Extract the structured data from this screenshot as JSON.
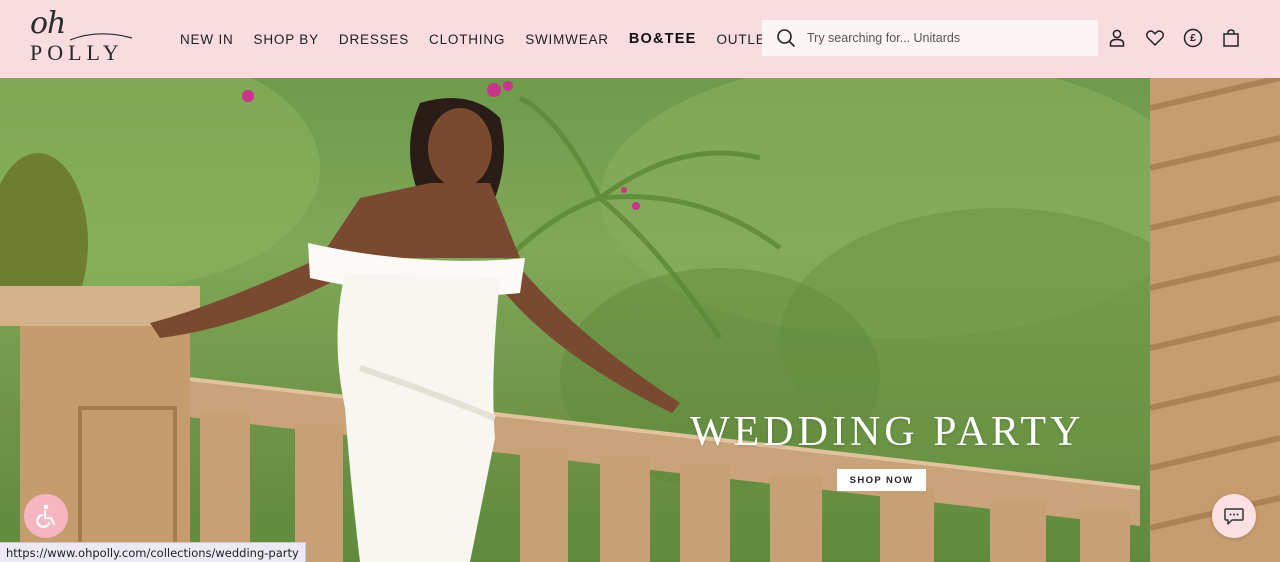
{
  "brand": {
    "logo_top": "oh",
    "logo_bottom": "POLLY"
  },
  "nav": {
    "items": [
      {
        "label": "NEW IN"
      },
      {
        "label": "SHOP BY"
      },
      {
        "label": "DRESSES"
      },
      {
        "label": "CLOTHING"
      },
      {
        "label": "SWIMWEAR"
      },
      {
        "label": "BO&TEE"
      },
      {
        "label": "OUTLET"
      }
    ]
  },
  "search": {
    "placeholder": "Try searching for... Unitards",
    "value": ""
  },
  "header_icons": [
    "account-icon",
    "wishlist-heart-icon",
    "currency-pound-icon",
    "shopping-bag-icon"
  ],
  "currency_symbol": "£",
  "hero": {
    "title": "WEDDING PARTY",
    "cta_label": "SHOP NOW"
  },
  "status_bar": {
    "url": "https://www.ohpolly.com/collections/wedding-party"
  },
  "colors": {
    "header_bg": "#f9dcdf",
    "accessibility_bg": "#f5b6c2",
    "chat_bg": "#fbe1e4"
  }
}
